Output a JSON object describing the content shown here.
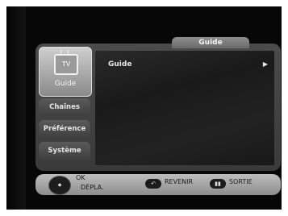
{
  "header": {
    "title": "Guide"
  },
  "sidebar": {
    "selected": {
      "label": "Guide",
      "icon": "tv-icon",
      "icon_text": "TV"
    },
    "items": [
      {
        "label": "Chaînes"
      },
      {
        "label": "Préférence"
      },
      {
        "label": "Système"
      }
    ]
  },
  "content": {
    "items": [
      {
        "label": "Guide",
        "arrow": "▶"
      }
    ]
  },
  "footer": {
    "ok_label": "OK",
    "move_label": "DÉPLA.",
    "back_label": "REVENIR",
    "exit_label": "SORTIE",
    "back_key_symbol": "↶",
    "exit_key_symbol": "▮▮"
  }
}
